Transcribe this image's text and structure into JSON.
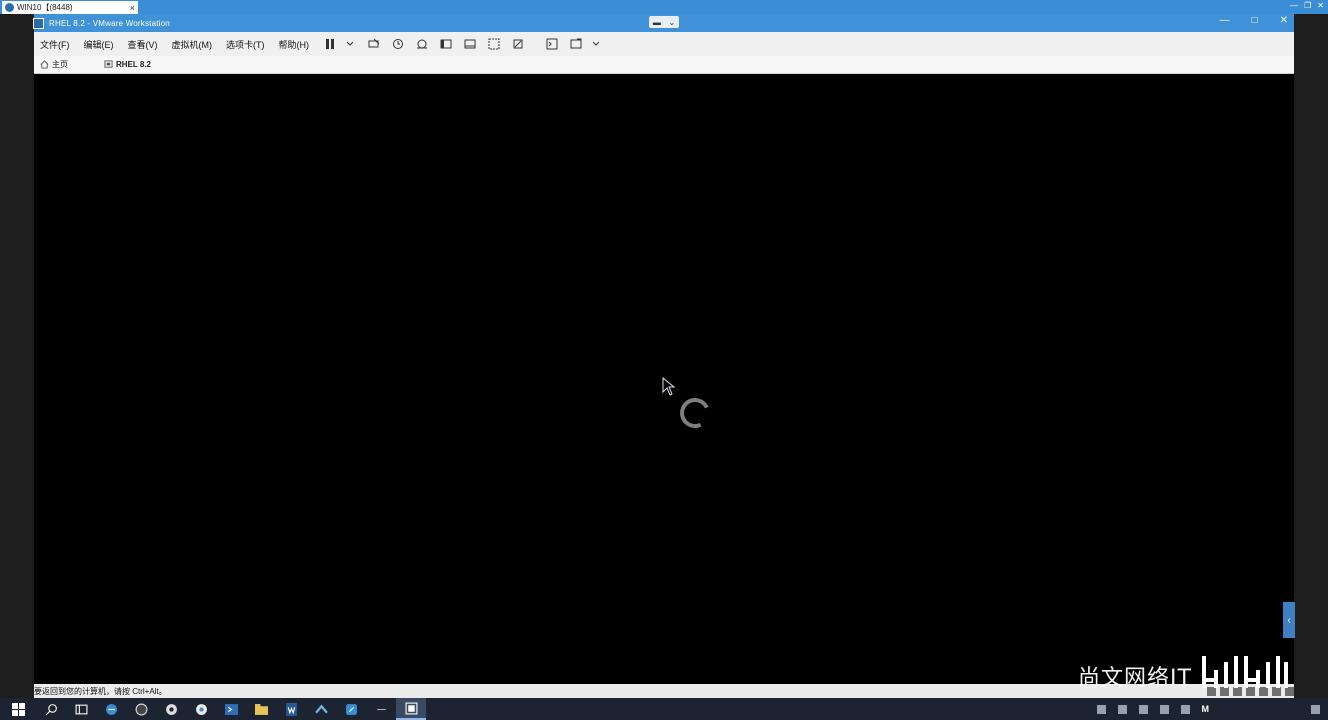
{
  "outer_tab": {
    "title": "WIN10【(8448)",
    "close": "×"
  },
  "window": {
    "title": "RHEL 8.2 - VMware Workstation",
    "controls": {
      "minimize": "—",
      "maximize": "□",
      "close": "✕"
    }
  },
  "menu": {
    "items": [
      "文件(F)",
      "编辑(E)",
      "查看(V)",
      "虚拟机(M)",
      "选项卡(T)",
      "帮助(H)"
    ]
  },
  "toolbar": {
    "icons": [
      "pause-icon",
      "send-ctrl-alt-del-icon",
      "snapshot-icon",
      "snapshot-manager-icon",
      "fullscreen-icon",
      "unity-icon",
      "console-view-icon",
      "stretch-icon",
      "terminal-icon",
      "settings-icon"
    ]
  },
  "tabs": [
    {
      "label": "主页",
      "icon": "home-icon"
    },
    {
      "label": "RHEL 8.2",
      "icon": "vm-icon"
    }
  ],
  "status": {
    "message": "要返回到您的计算机，请按 Ctrl+Alt。"
  },
  "watermark": {
    "text": "尚文网络IT"
  },
  "taskbar": {
    "apps": [
      "windows-start-icon",
      "search-icon",
      "task-view-icon",
      "edge-icon",
      "obs-icon",
      "app-icon-1",
      "chrome-icon",
      "powershell-icon",
      "file-explorer-icon",
      "word-icon",
      "network-icon",
      "app-icon-2",
      "app-icon-3",
      "vmware-icon"
    ],
    "tray_m": "M"
  },
  "colors": {
    "titlebar": "#3f91d8",
    "menubar": "#f0f0f0",
    "console": "#000000",
    "taskbar": "#1c2431"
  }
}
